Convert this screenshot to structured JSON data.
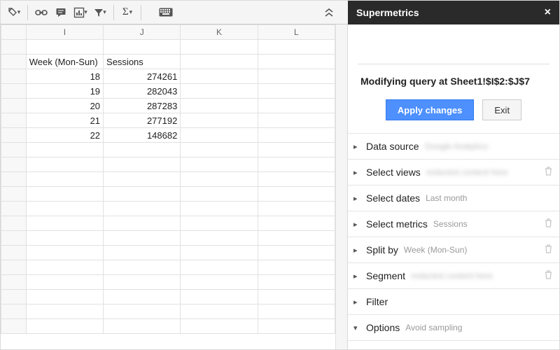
{
  "toolbar": {
    "icons": {
      "paint": "paint-format-icon",
      "link": "link-icon",
      "comment": "comment-icon",
      "chart": "insert-chart-icon",
      "filter": "filter-icon",
      "functions": "functions-icon",
      "keyboard": "keyboard-icon",
      "collapse": "collapse-icon"
    }
  },
  "sheet": {
    "columns": [
      "I",
      "J",
      "K",
      "L"
    ],
    "headers": {
      "I": "Week (Mon-Sun)",
      "J": "Sessions"
    },
    "rows": [
      {
        "I": "18",
        "J": "274261"
      },
      {
        "I": "19",
        "J": "282043"
      },
      {
        "I": "20",
        "J": "287283"
      },
      {
        "I": "21",
        "J": "277192"
      },
      {
        "I": "22",
        "J": "148682"
      }
    ],
    "blank_rows": 14
  },
  "sidebar": {
    "title": "Supermetrics",
    "heading": "Modifying query at Sheet1!$I$2:$J$7",
    "apply": "Apply changes",
    "exit": "Exit",
    "sections": [
      {
        "label": "Data source",
        "hint": "Google Analytics:",
        "blurred": true,
        "trash": false,
        "open": false
      },
      {
        "label": "Select views",
        "hint": "",
        "blurred": true,
        "trash": true,
        "open": false
      },
      {
        "label": "Select dates",
        "hint": "Last month",
        "blurred": false,
        "trash": false,
        "open": false
      },
      {
        "label": "Select metrics",
        "hint": "Sessions",
        "blurred": false,
        "trash": true,
        "open": false
      },
      {
        "label": "Split by",
        "hint": "Week (Mon-Sun)",
        "blurred": false,
        "trash": true,
        "open": false
      },
      {
        "label": "Segment",
        "hint": "",
        "blurred": true,
        "trash": true,
        "open": false
      },
      {
        "label": "Filter",
        "hint": "",
        "blurred": false,
        "trash": false,
        "open": false
      },
      {
        "label": "Options",
        "hint": "Avoid sampling",
        "blurred": false,
        "trash": false,
        "open": true
      }
    ]
  }
}
